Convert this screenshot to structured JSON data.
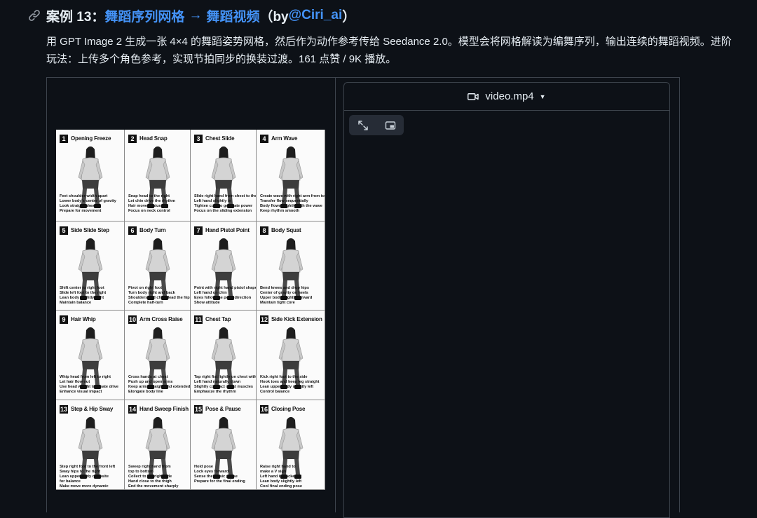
{
  "heading": {
    "prefix": "案例 13：",
    "link_text": "舞蹈序列网格",
    "arrow": "→",
    "link_text_2": "舞蹈视频",
    "by_open": "（by ",
    "author": "@Ciri_ai",
    "by_close": "）"
  },
  "description": "用 GPT Image 2 生成一张 4×4 的舞蹈姿势网格，然后作为动作参考传给 Seedance 2.0。模型会将网格解读为编舞序列，输出连续的舞蹈视频。进阶玩法：上传多个角色参考，实现节拍同步的换装过渡。161 点赞 / 9K 播放。",
  "video": {
    "filename": "video.mp4"
  },
  "icons": {
    "heading": "link-icon",
    "file": "video-camera-icon",
    "caret": "caret-down-icon",
    "expand": "expand-icon",
    "pip": "picture-in-picture-icon"
  },
  "poses": [
    {
      "num": "1",
      "title": "Opening Freeze",
      "notes": [
        "Feet shoulder-width apart",
        "Lower body's center of gravity",
        "Look straight ahead",
        "Prepare for movement"
      ]
    },
    {
      "num": "2",
      "title": "Head Snap",
      "notes": [
        "Snap head to the right",
        "Let chin drive the rhythm",
        "Hair moves naturally",
        "Focus on neck control"
      ]
    },
    {
      "num": "3",
      "title": "Chest Slide",
      "notes": [
        "Slide right hand from chest to the left",
        "Left hand slightly in",
        "Tighten core to generate power",
        "Focus on the sliding extension"
      ]
    },
    {
      "num": "4",
      "title": "Arm Wave",
      "notes": [
        "Create wave with right arm from top to bottom",
        "Transfer flow sequentially",
        "Body flows slightly with the wave",
        "Keep rhythm smooth"
      ]
    },
    {
      "num": "5",
      "title": "Side Slide Step",
      "notes": [
        "Shift center to right foot",
        "Slide left foot to the right",
        "Lean body slightly right",
        "Maintain balance"
      ]
    },
    {
      "num": "6",
      "title": "Body Turn",
      "notes": [
        "Pivot on right foot",
        "Turn body right and back",
        "Shoulders and chest lead the hip movement",
        "Complete half-turn"
      ]
    },
    {
      "num": "7",
      "title": "Hand Pistol Point",
      "notes": [
        "Point with right hand pistol shape forward",
        "Left hand on chin",
        "Eyes follow the point direction",
        "Show attitude"
      ]
    },
    {
      "num": "8",
      "title": "Body Squat",
      "notes": [
        "Bend knees and drop hips",
        "Center of gravity on heels",
        "Upper body slightly forward",
        "Maintain tight core"
      ]
    },
    {
      "num": "9",
      "title": "Hair Whip",
      "notes": [
        "Whip head from left to right",
        "Let hair flow out",
        "Use head weight to create drive",
        "Enhance visual impact"
      ]
    },
    {
      "num": "10",
      "title": "Arm Cross Raise",
      "notes": [
        "Cross hands at chest",
        "Push up and open arms",
        "Keep arms straight and extended",
        "Elongate body line"
      ]
    },
    {
      "num": "11",
      "title": "Chest Tap",
      "notes": [
        "Tap right fist lightly on chest with rhythm",
        "Left hand naturally down",
        "Slightly contract chest muscles",
        "Emphasize the rhythm"
      ]
    },
    {
      "num": "12",
      "title": "Side Kick Extension",
      "notes": [
        "Kick right foot to the side",
        "Hook toes and keep leg straight",
        "Lean upper body slightly left",
        "Control balance"
      ]
    },
    {
      "num": "13",
      "title": "Step & Hip Sway",
      "notes": [
        "Step right foot to the front left",
        "Sway hips to the right",
        "Lean upper body opposite",
        "for balance",
        "Make move more dynamic"
      ]
    },
    {
      "num": "14",
      "title": "Hand Sweep Finish",
      "notes": [
        "Sweep right hand from",
        "top to bottom",
        "Collect to the right side",
        "Hand close to the thigh",
        "End the movement sharply"
      ]
    },
    {
      "num": "15",
      "title": "Pose & Pause",
      "notes": [
        "Hold pose",
        "Lock eyes forward",
        "Sense the music pause",
        "Prepare for the final ending"
      ]
    },
    {
      "num": "16",
      "title": "Closing Pose",
      "notes": [
        "Raise right hand to",
        "make a V sign",
        "Left hand in pocket",
        "Lean body slightly left",
        "Cool final ending pose"
      ]
    }
  ]
}
